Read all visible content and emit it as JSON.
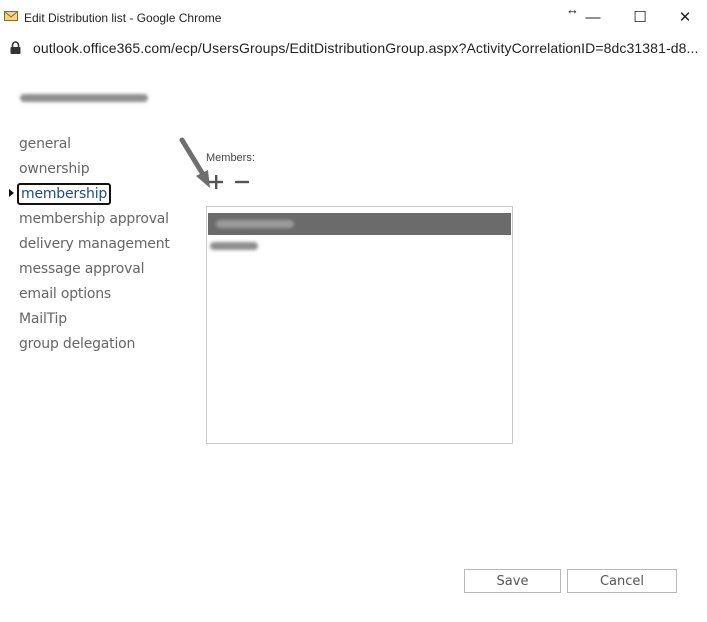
{
  "window": {
    "title": "Edit Distribution list - Google Chrome",
    "minimize_glyph": "—",
    "maximize_glyph": "☐",
    "close_glyph": "✕"
  },
  "address": {
    "url": "outlook.office365.com/ecp/UsersGroups/EditDistributionGroup.aspx?ActivityCorrelationID=8dc31381-d8..."
  },
  "nav": {
    "items": [
      {
        "label": "general"
      },
      {
        "label": "ownership"
      },
      {
        "label": "membership"
      },
      {
        "label": "membership approval"
      },
      {
        "label": "delivery management"
      },
      {
        "label": "message approval"
      },
      {
        "label": "email options"
      },
      {
        "label": "MailTip"
      },
      {
        "label": "group delegation"
      }
    ],
    "active_index": 2
  },
  "members": {
    "label": "Members:",
    "add_glyph": "+",
    "remove_glyph": "−"
  },
  "footer": {
    "save_label": "Save",
    "cancel_label": "Cancel"
  },
  "colors": {
    "selected_row": "#6b6b6b",
    "active_nav_text": "#1e4e79"
  }
}
